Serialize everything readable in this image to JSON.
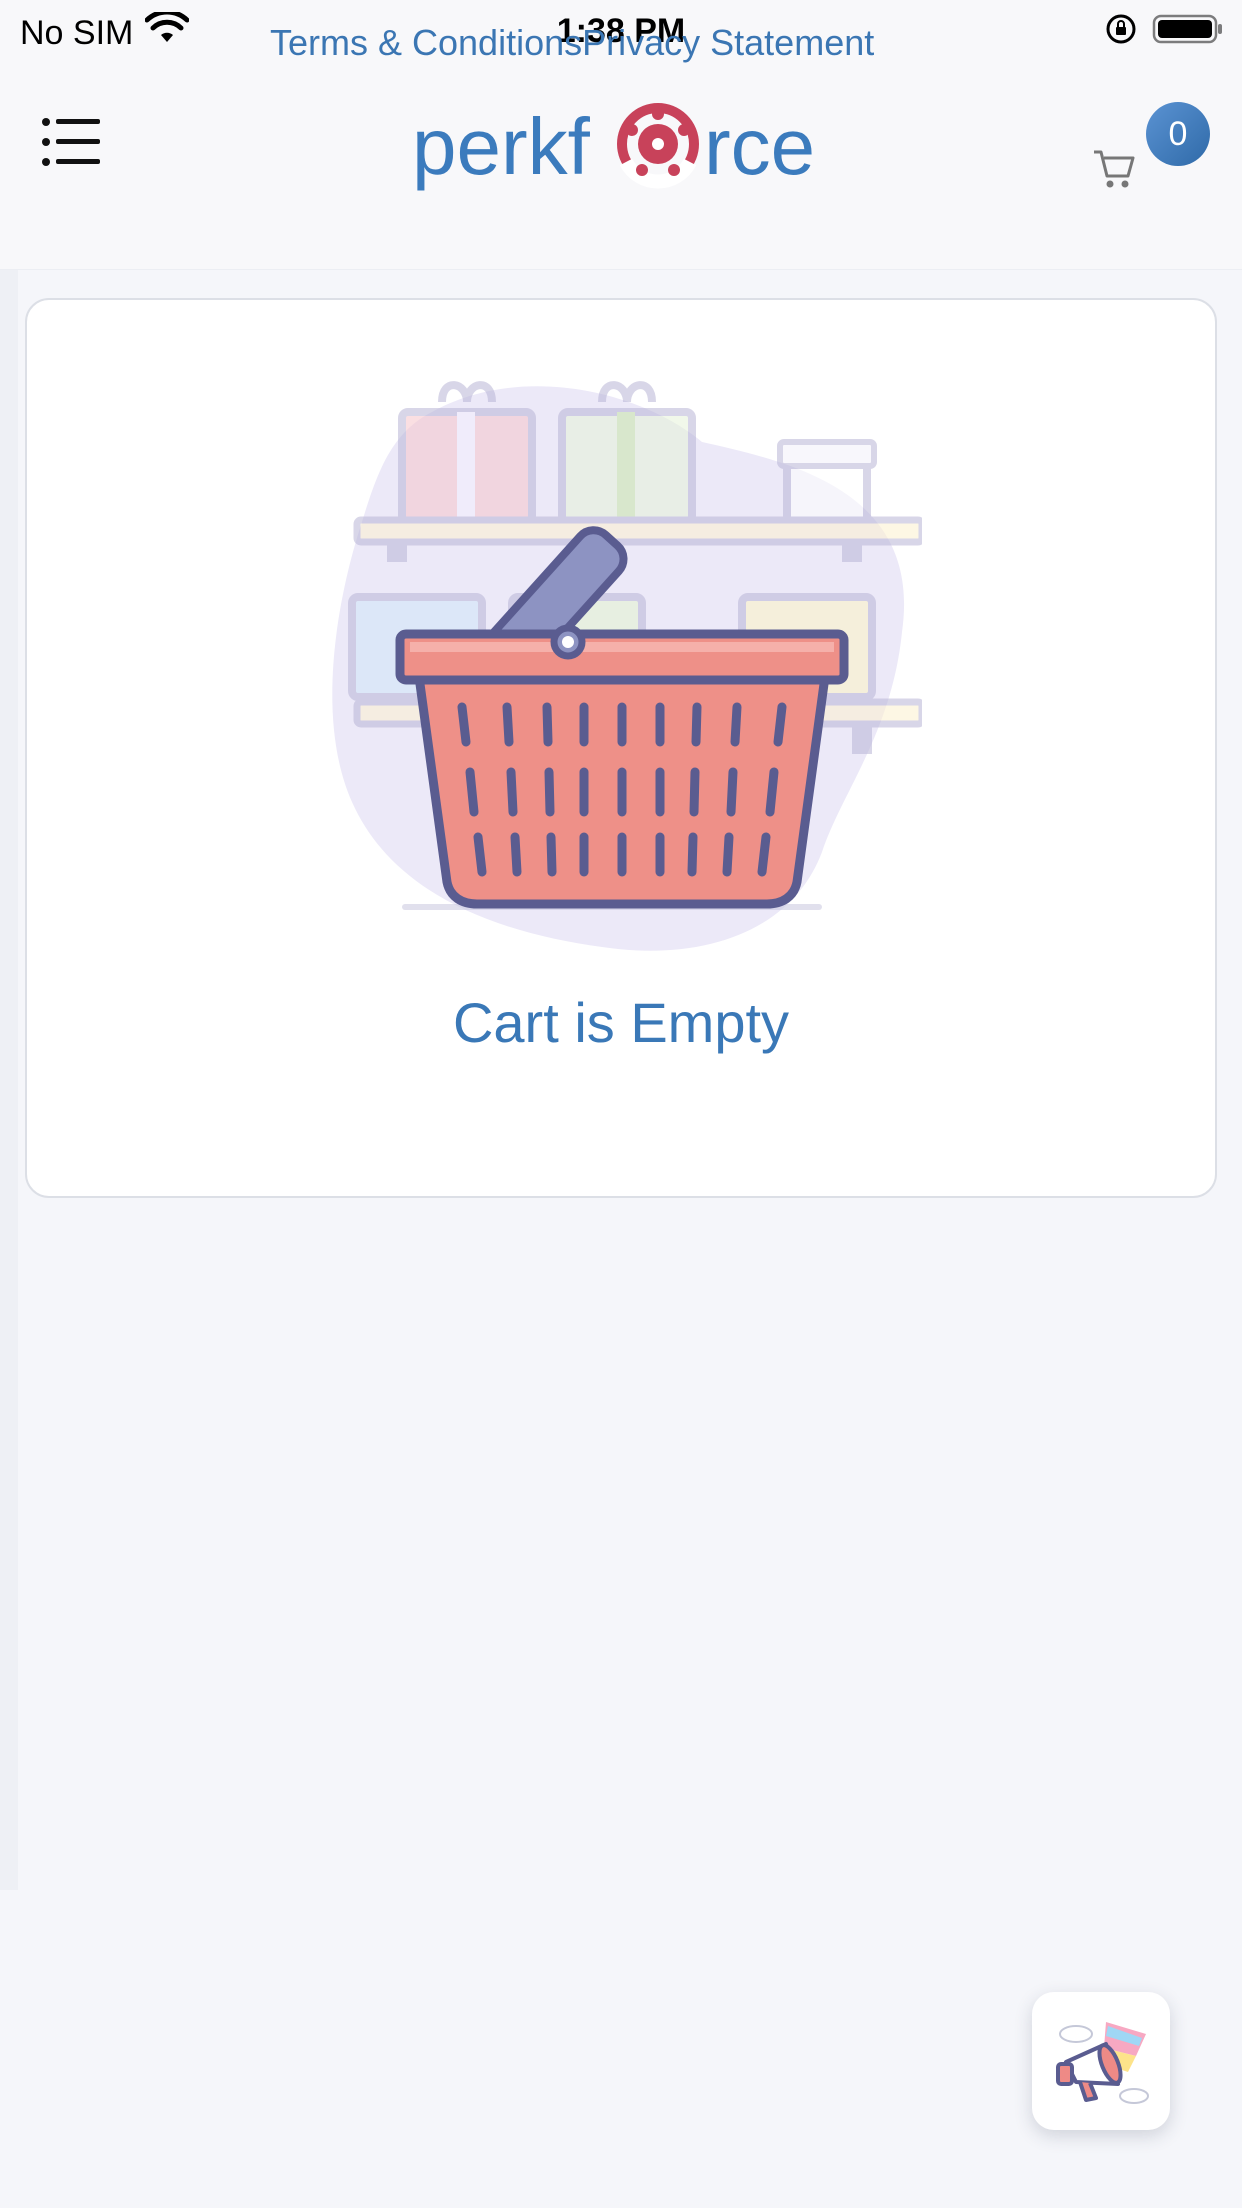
{
  "status_bar": {
    "carrier": "No SIM",
    "time": "1:38 PM"
  },
  "header": {
    "logo_text_left": "perkf",
    "logo_text_right": "rce",
    "cart_count": "0"
  },
  "card": {
    "empty_message": "Cart is Empty"
  },
  "footer": {
    "terms_label": "Terms & Conditions",
    "privacy_label": "Privacy Statement"
  },
  "colors": {
    "brand_blue": "#3b7bbd",
    "brand_red": "#c8425a",
    "badge_blue": "#4a86c8"
  },
  "icons": [
    "wifi-icon",
    "rotation-lock-icon",
    "battery-icon",
    "menu-list-icon",
    "cart-icon",
    "shopping-basket-illustration",
    "megaphone-icon"
  ]
}
